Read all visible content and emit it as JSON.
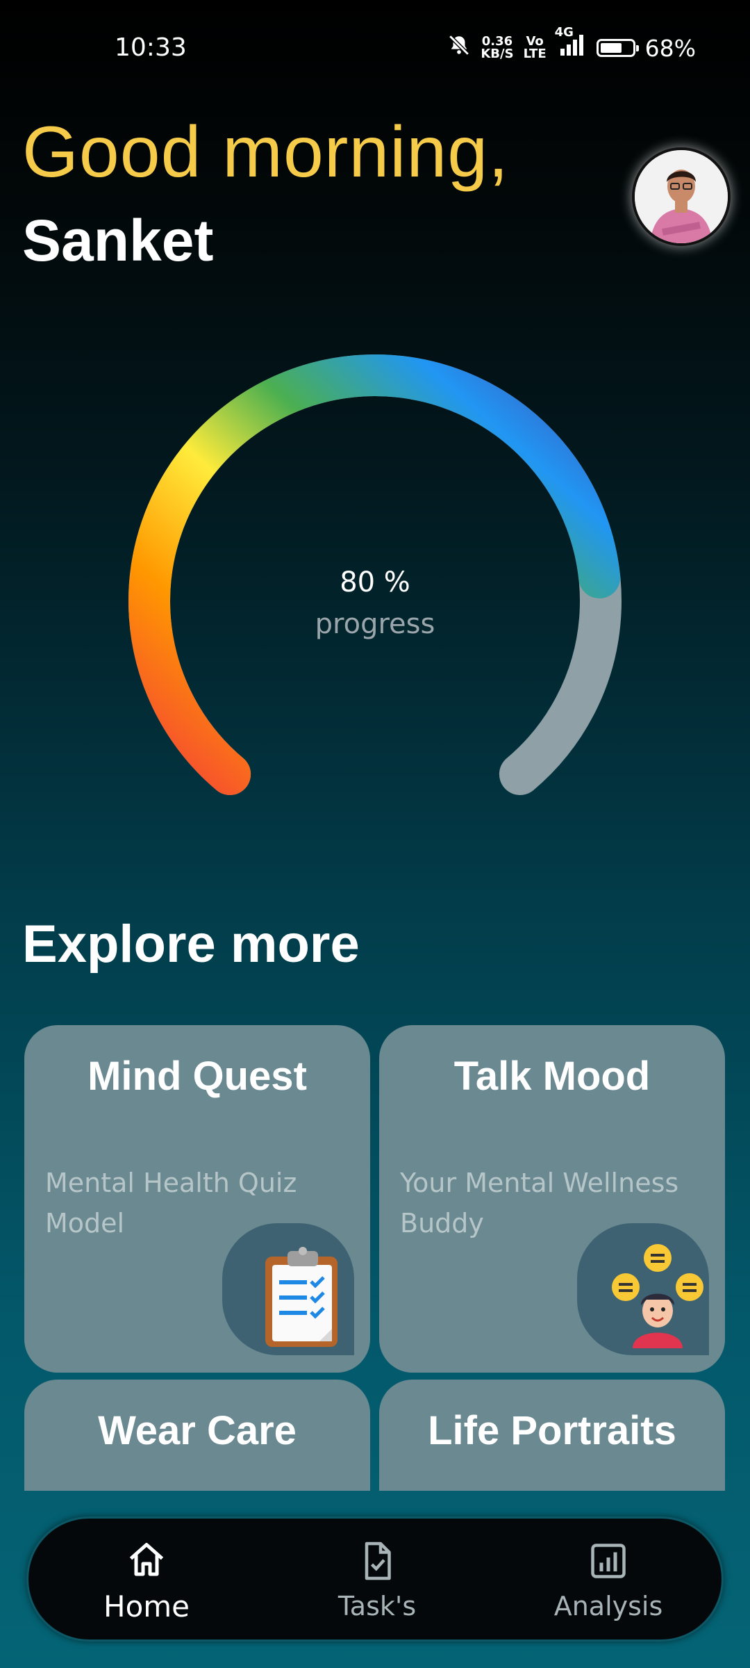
{
  "status_bar": {
    "time": "10:33",
    "network_speed_value": "0.36",
    "network_speed_unit": "KB/S",
    "volte_top": "Vo",
    "volte_bottom": "LTE",
    "network_type": "4G",
    "battery": "68%",
    "battery_level": 0.68
  },
  "header": {
    "greeting": "Good morning,",
    "name": "Sanket"
  },
  "progress": {
    "value_text": "80 %",
    "label": "progress",
    "level": 0.8
  },
  "explore": {
    "title": "Explore more",
    "cards": [
      {
        "title": "Mind Quest",
        "description": "Mental Health Quiz Model",
        "icon": "clipboard-checklist-icon"
      },
      {
        "title": "Talk Mood",
        "description": "Your Mental Wellness Buddy",
        "icon": "person-chat-bubbles-icon"
      },
      {
        "title": "Wear Care"
      },
      {
        "title": "Life Portraits"
      }
    ]
  },
  "bottom_nav": {
    "items": [
      {
        "label": "Home",
        "icon": "home-icon",
        "active": true
      },
      {
        "label": "Task's",
        "icon": "task-document-icon",
        "active": false
      },
      {
        "label": "Analysis",
        "icon": "bar-chart-icon",
        "active": false
      }
    ]
  },
  "colors": {
    "greeting": "#f6cb4a",
    "card_bg": "#6a8991",
    "badge_bg": "#3e6272",
    "gauge_track": "#8fa0a6"
  }
}
